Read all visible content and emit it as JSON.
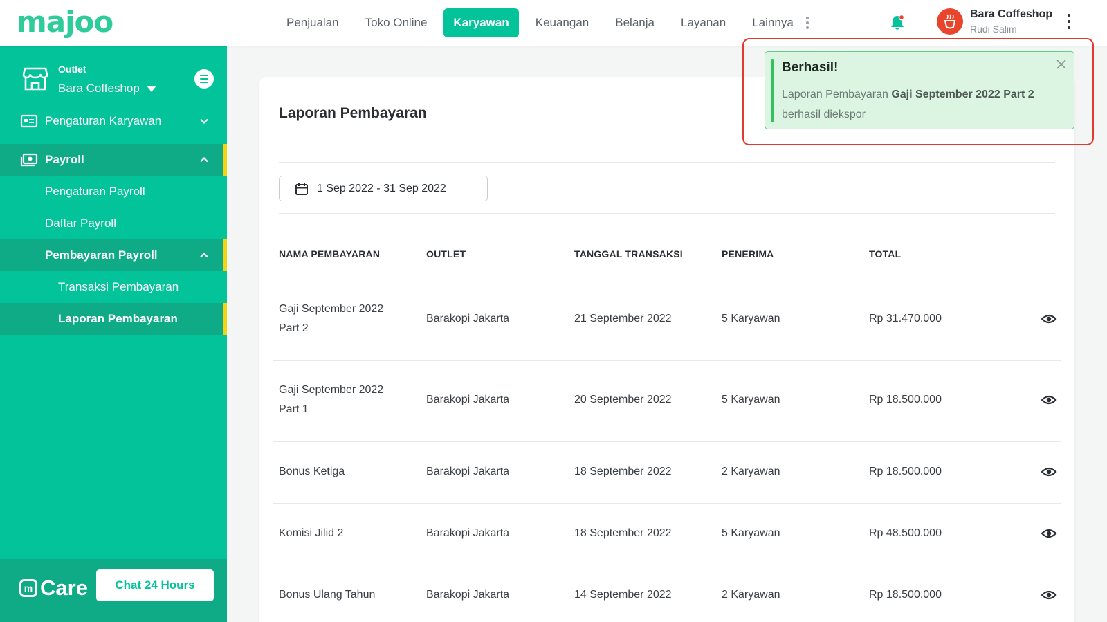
{
  "brand": {
    "logo_text": "majoo"
  },
  "nav": {
    "items": [
      "Penjualan",
      "Toko Online",
      "Karyawan",
      "Keuangan",
      "Belanja",
      "Layanan",
      "Lainnya"
    ],
    "active": "Karyawan"
  },
  "user": {
    "name": "Bara Coffeshop",
    "subtitle": "Rudi Salim"
  },
  "sidebar": {
    "outlet_label": "Outlet",
    "outlet_name": "Bara Coffeshop",
    "items": [
      {
        "label": "Pengaturan Karyawan"
      },
      {
        "label": "Payroll"
      },
      {
        "label": "Pengaturan Payroll"
      },
      {
        "label": "Daftar Payroll"
      },
      {
        "label": "Pembayaran Payroll"
      },
      {
        "label": "Transaksi Pembayaran"
      },
      {
        "label": "Laporan Pembayaran"
      }
    ],
    "care_text": "Care",
    "care_mark": "m",
    "chat_label": "Chat 24 Hours"
  },
  "page": {
    "title": "Laporan Pembayaran",
    "date_range": "1 Sep 2022 - 31 Sep 2022"
  },
  "table": {
    "headers": [
      "NAMA PEMBAYARAN",
      "OUTLET",
      "TANGGAL TRANSAKSI",
      "PENERIMA",
      "TOTAL"
    ],
    "rows": [
      {
        "name_line1": "Gaji September 2022",
        "name_line2": "Part 2",
        "outlet": "Barakopi Jakarta",
        "date": "21 September 2022",
        "recipients": "5 Karyawan",
        "total": "Rp 31.470.000"
      },
      {
        "name_line1": "Gaji September 2022",
        "name_line2": "Part 1",
        "outlet": "Barakopi Jakarta",
        "date": "20 September 2022",
        "recipients": "5 Karyawan",
        "total": "Rp 18.500.000"
      },
      {
        "name_line1": "Bonus Ketiga",
        "name_line2": "",
        "outlet": "Barakopi Jakarta",
        "date": "18 September 2022",
        "recipients": "2 Karyawan",
        "total": "Rp 18.500.000"
      },
      {
        "name_line1": "Komisi Jilid 2",
        "name_line2": "",
        "outlet": "Barakopi Jakarta",
        "date": "18 September 2022",
        "recipients": "5 Karyawan",
        "total": "Rp 48.500.000"
      },
      {
        "name_line1": "Bonus Ulang Tahun",
        "name_line2": "",
        "outlet": "Barakopi Jakarta",
        "date": "14 September 2022",
        "recipients": "2 Karyawan",
        "total": "Rp 18.500.000"
      }
    ]
  },
  "toast": {
    "title": "Berhasil!",
    "body_prefix": "Laporan Pembayaran ",
    "body_bold": "Gaji September 2022 Part 2",
    "body_suffix": "berhasil diekspor"
  },
  "colors": {
    "brand": "#02c39a",
    "sidebar_dark": "#0fab86",
    "accent": "#f5d30f",
    "toast_bg": "#dcf5e3",
    "toast_bar": "#31c25d",
    "highlight_outline": "#e23a2e"
  }
}
